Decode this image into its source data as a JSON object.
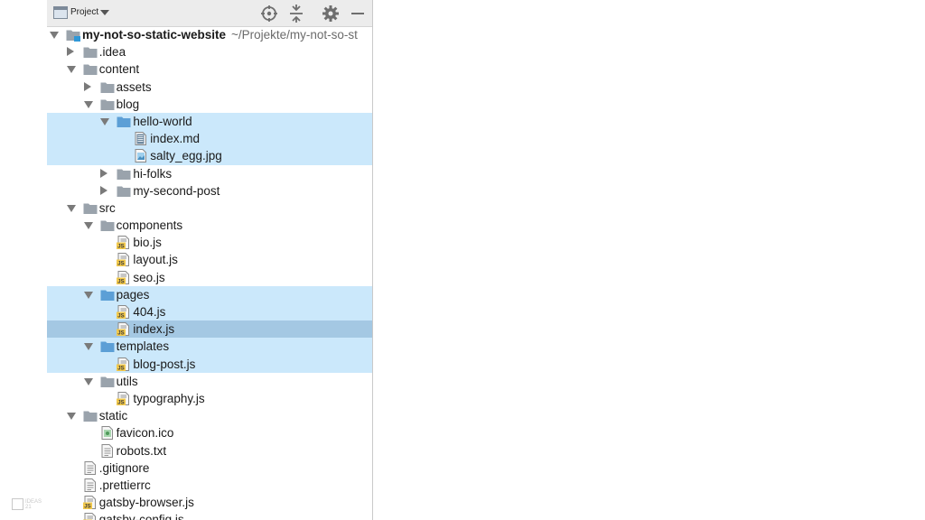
{
  "toolbar": {
    "view_label": "Project",
    "icons": [
      "locate-icon",
      "collapse-all-icon",
      "gear-icon",
      "minimize-icon"
    ]
  },
  "watermark": "IDEAS 21",
  "colors": {
    "folder": "#9aa3ac",
    "folder_highlight": "#5c9fd6",
    "row_highlight": "#cbe8fb",
    "row_selected": "#a4c8e3",
    "js_badge": "#f2c94c"
  },
  "tree": [
    {
      "label": "my-not-so-static-website",
      "path": "~/Projekte/my-not-so-st",
      "depth": 0,
      "kind": "root",
      "expanded": true
    },
    {
      "label": ".idea",
      "depth": 1,
      "kind": "folder",
      "expanded": false
    },
    {
      "label": "content",
      "depth": 1,
      "kind": "folder",
      "expanded": true
    },
    {
      "label": "assets",
      "depth": 2,
      "kind": "folder",
      "expanded": false
    },
    {
      "label": "blog",
      "depth": 2,
      "kind": "folder",
      "expanded": true
    },
    {
      "label": "hello-world",
      "depth": 3,
      "kind": "folder",
      "expanded": true,
      "highlight": true,
      "blue": true
    },
    {
      "label": "index.md",
      "depth": 4,
      "kind": "md",
      "highlight": true
    },
    {
      "label": "salty_egg.jpg",
      "depth": 4,
      "kind": "image",
      "highlight": true
    },
    {
      "label": "hi-folks",
      "depth": 3,
      "kind": "folder",
      "expanded": false
    },
    {
      "label": "my-second-post",
      "depth": 3,
      "kind": "folder",
      "expanded": false
    },
    {
      "label": "src",
      "depth": 1,
      "kind": "folder",
      "expanded": true
    },
    {
      "label": "components",
      "depth": 2,
      "kind": "folder",
      "expanded": true
    },
    {
      "label": "bio.js",
      "depth": 3,
      "kind": "js"
    },
    {
      "label": "layout.js",
      "depth": 3,
      "kind": "js"
    },
    {
      "label": "seo.js",
      "depth": 3,
      "kind": "js"
    },
    {
      "label": "pages",
      "depth": 2,
      "kind": "folder",
      "expanded": true,
      "highlight": true,
      "blue": true
    },
    {
      "label": "404.js",
      "depth": 3,
      "kind": "js",
      "highlight": true
    },
    {
      "label": "index.js",
      "depth": 3,
      "kind": "js",
      "selected": true
    },
    {
      "label": "templates",
      "depth": 2,
      "kind": "folder",
      "expanded": true,
      "highlight": true,
      "blue": true
    },
    {
      "label": "blog-post.js",
      "depth": 3,
      "kind": "js",
      "highlight": true
    },
    {
      "label": "utils",
      "depth": 2,
      "kind": "folder",
      "expanded": true
    },
    {
      "label": "typography.js",
      "depth": 3,
      "kind": "js"
    },
    {
      "label": "static",
      "depth": 1,
      "kind": "folder",
      "expanded": true
    },
    {
      "label": "favicon.ico",
      "depth": 2,
      "kind": "ico"
    },
    {
      "label": "robots.txt",
      "depth": 2,
      "kind": "text"
    },
    {
      "label": ".gitignore",
      "depth": 1,
      "kind": "text"
    },
    {
      "label": ".prettierrc",
      "depth": 1,
      "kind": "text"
    },
    {
      "label": "gatsby-browser.js",
      "depth": 1,
      "kind": "js"
    },
    {
      "label": "gatsby-config.js",
      "depth": 1,
      "kind": "js"
    }
  ]
}
